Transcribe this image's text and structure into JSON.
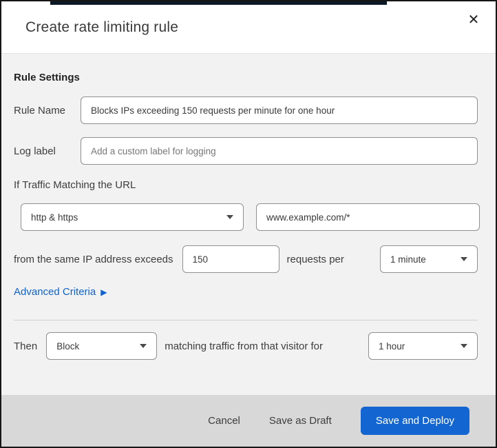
{
  "colors": {
    "accent_blue": "#1365d2",
    "link_blue": "#0f62cc",
    "body_bg": "#f2f2f2",
    "footer_bg": "#d8d8d8",
    "top_strip": "#0c1a28",
    "input_border": "#8f8f8f"
  },
  "modal": {
    "title": "Create rate limiting rule",
    "close_glyph": "✕"
  },
  "form": {
    "section_heading": "Rule Settings",
    "rule_name": {
      "label": "Rule Name",
      "value": "Blocks IPs exceeding 150 requests per minute for one hour"
    },
    "log_label": {
      "label": "Log label",
      "placeholder": "Add a custom label for logging"
    },
    "traffic": {
      "heading": "If Traffic Matching the URL",
      "scheme_selected": "http & https",
      "url_value": "www.example.com/*"
    },
    "threshold": {
      "prefix": "from the same IP address exceeds",
      "requests_value": "150",
      "connector": "requests per",
      "period_selected": "1 minute"
    },
    "advanced_criteria": {
      "label": "Advanced Criteria",
      "expand_glyph": "▶"
    },
    "action": {
      "prefix": "Then",
      "action_selected": "Block",
      "connector": "matching traffic from that visitor for",
      "duration_selected": "1 hour"
    }
  },
  "footer": {
    "cancel_label": "Cancel",
    "save_draft_label": "Save as Draft",
    "save_deploy_label": "Save and Deploy"
  }
}
